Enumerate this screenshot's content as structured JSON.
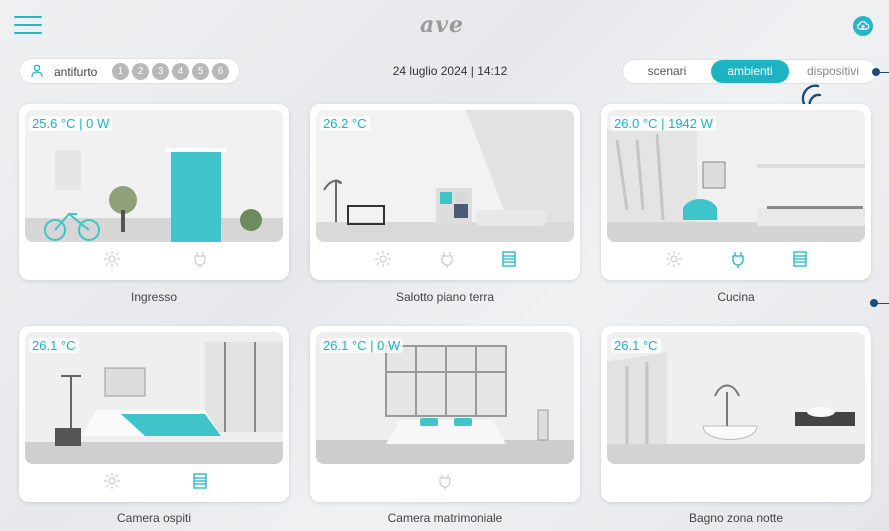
{
  "header": {
    "logo": "ave",
    "menu_icon": "hamburger-menu-icon",
    "cloud_icon": "cloud-upload-icon",
    "accent": "#1eb3c2"
  },
  "alarm": {
    "label": "antifurto",
    "icon": "alarm-person-icon",
    "zones": [
      "1",
      "2",
      "3",
      "4",
      "5",
      "6"
    ]
  },
  "datetime": "24 luglio 2024 | 14:12",
  "tabs": [
    {
      "label": "scenari",
      "active": false
    },
    {
      "label": "ambienti",
      "active": true
    },
    {
      "label": "dispositivi",
      "active": false
    }
  ],
  "rooms": [
    {
      "name": "Ingresso",
      "reading": "25.6 °C | 0 W",
      "icons": [
        "light-bulb-icon",
        "plug-icon"
      ]
    },
    {
      "name": "Salotto piano terra",
      "reading": "26.2 °C",
      "icons": [
        "light-bulb-icon",
        "plug-icon",
        "shutter-icon"
      ]
    },
    {
      "name": "Cucina",
      "reading": "26.0 °C | 1942 W",
      "icons": [
        "light-bulb-icon",
        "plug-icon",
        "shutter-icon"
      ]
    },
    {
      "name": "Camera ospiti",
      "reading": "26.1 °C",
      "icons": [
        "light-bulb-icon",
        "shutter-icon"
      ]
    },
    {
      "name": "Camera matrimoniale",
      "reading": "26.1 °C | 0 W",
      "icons": [
        "plug-icon"
      ]
    },
    {
      "name": "Bagno zona notte",
      "reading": "26.1 °C",
      "icons": []
    }
  ]
}
